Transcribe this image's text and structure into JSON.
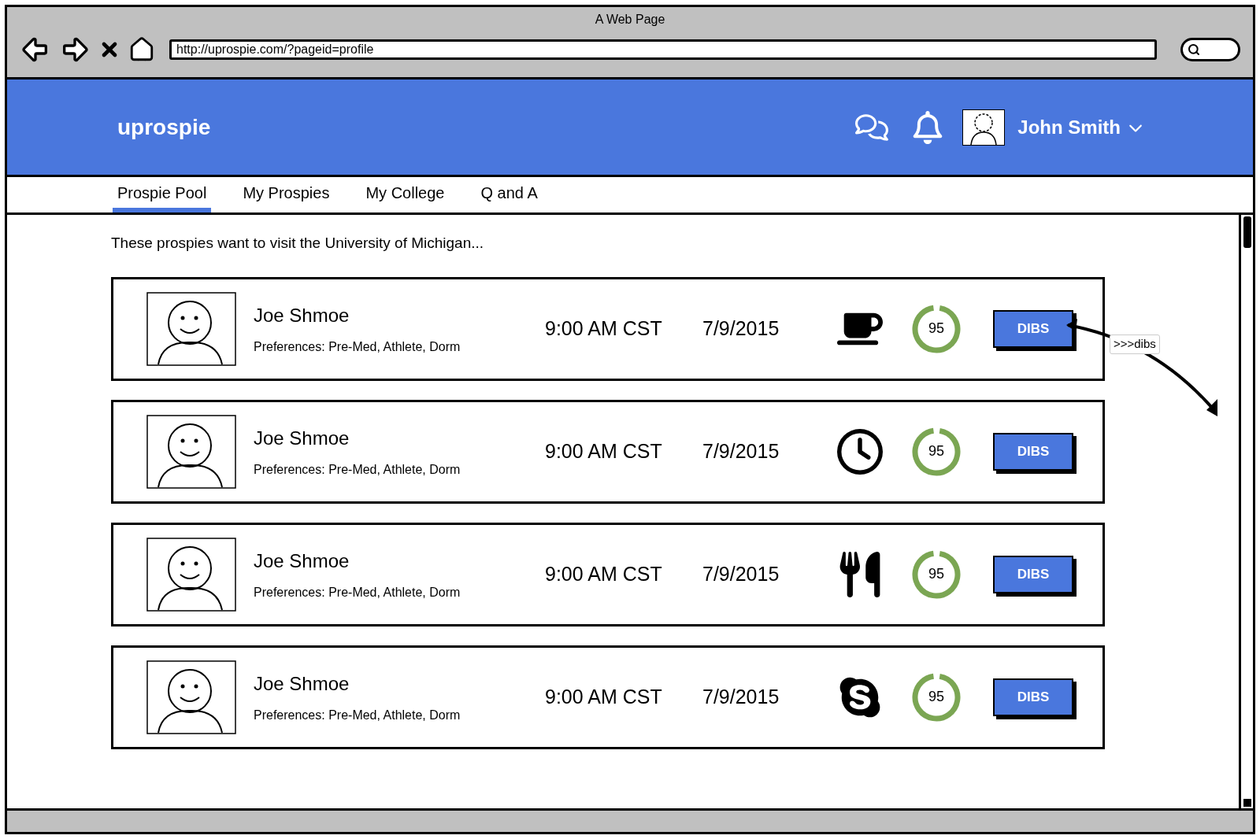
{
  "window": {
    "title": "A Web Page",
    "url": "http://uprospie.com/?pageid=profile"
  },
  "header": {
    "logo": "uprospie",
    "user_name": "John Smith"
  },
  "tabs": [
    {
      "label": "Prospie Pool",
      "selected": true
    },
    {
      "label": "My Prospies",
      "selected": false
    },
    {
      "label": "My College",
      "selected": false
    },
    {
      "label": "Q and A",
      "selected": false
    }
  ],
  "intro": "These prospies want to visit the University of Michigan...",
  "prospies": [
    {
      "name": "Joe Shmoe",
      "preferences": "Preferences: Pre-Med, Athlete, Dorm",
      "time": "9:00 AM CST",
      "date": "7/9/2015",
      "kind": "coffee",
      "score": "95",
      "level": 0.95,
      "button": "DIBS"
    },
    {
      "name": "Joe Shmoe",
      "preferences": "Preferences: Pre-Med, Athlete, Dorm",
      "time": "9:00 AM CST",
      "date": "7/9/2015",
      "kind": "clock",
      "score": "95",
      "level": 0.95,
      "button": "DIBS"
    },
    {
      "name": "Joe Shmoe",
      "preferences": "Preferences: Pre-Med, Athlete, Dorm",
      "time": "9:00 AM CST",
      "date": "7/9/2015",
      "kind": "meal",
      "score": "95",
      "level": 0.95,
      "button": "DIBS"
    },
    {
      "name": "Joe Shmoe",
      "preferences": "Preferences: Pre-Med, Athlete, Dorm",
      "time": "9:00 AM CST",
      "date": "7/9/2015",
      "kind": "skype",
      "score": "95",
      "level": 0.95,
      "button": "DIBS"
    }
  ],
  "annotation": {
    "label": ">>>dibs"
  }
}
